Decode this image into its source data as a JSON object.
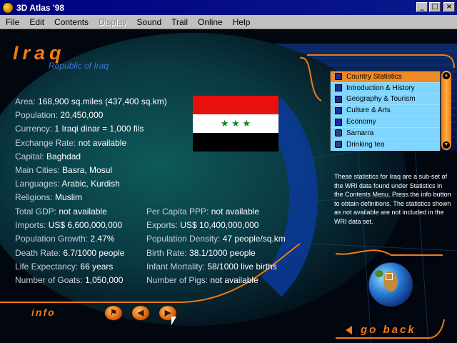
{
  "window": {
    "title": "3D Atlas '98",
    "buttons": {
      "minimize": "_",
      "maximize": "□",
      "close": "×"
    }
  },
  "menu": [
    {
      "label": "File",
      "disabled": false
    },
    {
      "label": "Edit",
      "disabled": false
    },
    {
      "label": "Contents",
      "disabled": false
    },
    {
      "label": "Display",
      "disabled": true
    },
    {
      "label": "Sound",
      "disabled": false
    },
    {
      "label": "Trail",
      "disabled": false
    },
    {
      "label": "Online",
      "disabled": false
    },
    {
      "label": "Help",
      "disabled": false
    }
  ],
  "country": {
    "name": "Iraq",
    "full_name": "Republic of Iraq",
    "flag_stars": "★ ★ ★"
  },
  "stats_top": [
    {
      "label": "Area:",
      "value": "168,900 sq.miles (437,400 sq.km)"
    },
    {
      "label": "Population:",
      "value": "20,450,000"
    },
    {
      "label": "Currency:",
      "value": "1 Iraqi dinar = 1,000 fils"
    },
    {
      "label": "Exchange Rate:",
      "value": "not available"
    },
    {
      "label": "Capital:",
      "value": "Baghdad"
    },
    {
      "label": "Main Cities:",
      "value": "Basra, Mosul"
    },
    {
      "label": "Languages:",
      "value": "Arabic, Kurdish"
    },
    {
      "label": "Religions:",
      "value": "Muslim"
    }
  ],
  "stats_left": [
    {
      "label": "Total GDP:",
      "value": "not available"
    },
    {
      "label": "Imports:",
      "value": "US$ 6,600,000,000"
    },
    {
      "label": "Population Growth:",
      "value": "2.47%"
    },
    {
      "label": "Death Rate:",
      "value": "6.7/1000 people"
    },
    {
      "label": "Life Expectancy:",
      "value": "66 years"
    },
    {
      "label": "Number of Goats:",
      "value": "1,050,000"
    }
  ],
  "stats_right": [
    {
      "label": "Per Capita PPP:",
      "value": "not available"
    },
    {
      "label": "Exports:",
      "value": "US$ 10,400,000,000"
    },
    {
      "label": "Population Density:",
      "value": "47 people/sq.km"
    },
    {
      "label": "Birth Rate:",
      "value": "38.1/1000 people"
    },
    {
      "label": "Infant Mortality:",
      "value": "58/1000 live births"
    },
    {
      "label": "Number of Pigs:",
      "value": "not available"
    }
  ],
  "topics": [
    {
      "label": "Country Statistics",
      "selected": true,
      "icon": "page-icon"
    },
    {
      "label": "Introduction & History",
      "selected": false,
      "icon": "page-icon"
    },
    {
      "label": "Geography & Tourism",
      "selected": false,
      "icon": "page-icon"
    },
    {
      "label": "Culture & Arts",
      "selected": false,
      "icon": "page-icon"
    },
    {
      "label": "Economy",
      "selected": false,
      "icon": "page-icon"
    },
    {
      "label": "Samarra",
      "selected": false,
      "icon": "camera-icon"
    },
    {
      "label": "Drinking tea",
      "selected": false,
      "icon": "camera-icon"
    }
  ],
  "info_text": "These statistics for Iraq are a sub-set of the WRI data found under Statistics in the Contents Menu. Press the info button to obtain definitions. The statistics shown as not available are not included in the WRI data set.",
  "labels": {
    "info": "info",
    "go_back": "go back"
  },
  "colors": {
    "accent": "#f07a14",
    "subtitle": "#3a78d8",
    "list_bg": "#7fd6ff",
    "list_selected": "#f08a24"
  }
}
